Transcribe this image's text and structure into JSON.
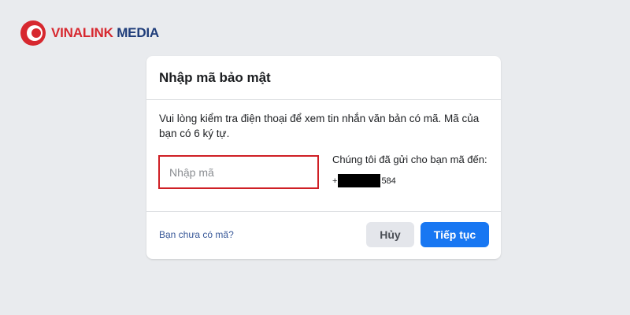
{
  "brand": {
    "name_part1": "VINALINK",
    "name_part2": "MEDIA",
    "colors": {
      "red": "#d7282f",
      "blue": "#1f3d7a"
    }
  },
  "dialog": {
    "title": "Nhập mã bảo mật",
    "instructions": "Vui lòng kiểm tra điện thoại để xem tin nhắn văn bản có mã. Mã của bạn có 6 ký tự.",
    "code_input": {
      "placeholder": "Nhập mã",
      "value": ""
    },
    "sent_label": "Chúng tôi đã gửi cho bạn mã đến:",
    "phone_prefix": "+",
    "phone_suffix": "584",
    "no_code_link": "Bạn chưa có mã?",
    "cancel_label": "Hủy",
    "continue_label": "Tiếp tục"
  },
  "colors": {
    "background": "#e9ebee",
    "primary_button": "#1877f2",
    "input_highlight": "#cf1f25",
    "link": "#385898"
  }
}
